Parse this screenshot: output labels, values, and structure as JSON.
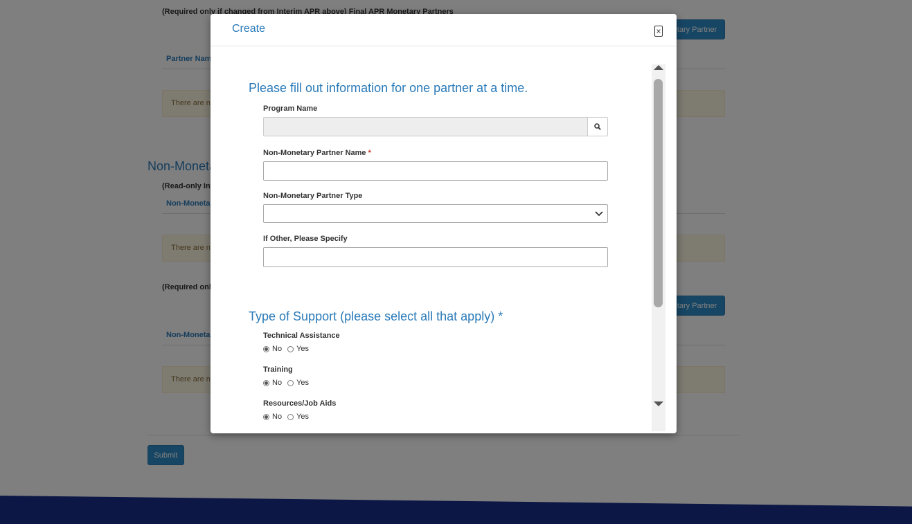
{
  "background": {
    "required_final_monetary": "(Required only if changed from Interim APR above) Final APR Monetary Partners",
    "partner_name_header": "Partner Name",
    "alert_1": "There are no",
    "section_non_monetary": "Non-Moneta",
    "readonly_interim": "(Read-only Int",
    "non_monetary_header_1": "Non-Monetar",
    "alert_2": "There are no",
    "required_only": "(Required only",
    "non_monetary_header_2": "Non-Monetar",
    "alert_3": "There are no",
    "add_monetary_partner_label": "etary Partner",
    "add_non_monetary_partner_label": "etary Partner",
    "submit_label": "Submit"
  },
  "modal": {
    "title": "Create",
    "close_icon": "×",
    "intro_heading": "Please fill out information for one partner at a time.",
    "fields": {
      "program_name_label": "Program Name",
      "program_name_value": "",
      "partner_name_label": "Non-Monetary Partner Name",
      "partner_name_required": "*",
      "partner_name_value": "",
      "partner_type_label": "Non-Monetary Partner Type",
      "partner_type_value": "",
      "other_specify_label": "If Other, Please Specify",
      "other_specify_value": ""
    },
    "support_heading": "Type of Support (please select all that apply) *",
    "support_items": [
      {
        "label": "Technical Assistance",
        "no": "No",
        "yes": "Yes",
        "selected": "No"
      },
      {
        "label": "Training",
        "no": "No",
        "yes": "Yes",
        "selected": "No"
      },
      {
        "label": "Resources/Job Aids",
        "no": "No",
        "yes": "Yes",
        "selected": "No"
      }
    ]
  },
  "colors": {
    "accent": "#2a7ab8",
    "button": "#2e8cc9",
    "footer": "#1a2f8a",
    "alert_bg": "#fcf8e3"
  },
  "icons": {
    "search": "search-icon",
    "close": "close-icon",
    "dropdown": "chevron-down-icon"
  }
}
